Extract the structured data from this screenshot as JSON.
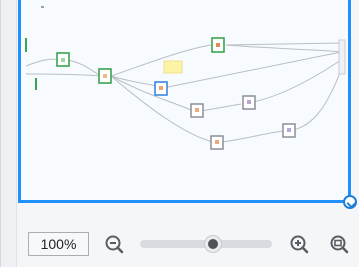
{
  "zoom": {
    "level_label": "100%",
    "slider_value": 0.55
  },
  "colors": {
    "accent": "#1e90ff",
    "node_green": "#2e9e45",
    "node_blue": "#2f7fd8",
    "node_gray": "#8a8f97",
    "highlight": "#fbf3a6"
  },
  "icons": {
    "zoom_out": "zoom-out-icon",
    "zoom_in": "zoom-in-icon",
    "fit": "fit-to-screen-icon",
    "resize": "resize-handle-icon"
  }
}
